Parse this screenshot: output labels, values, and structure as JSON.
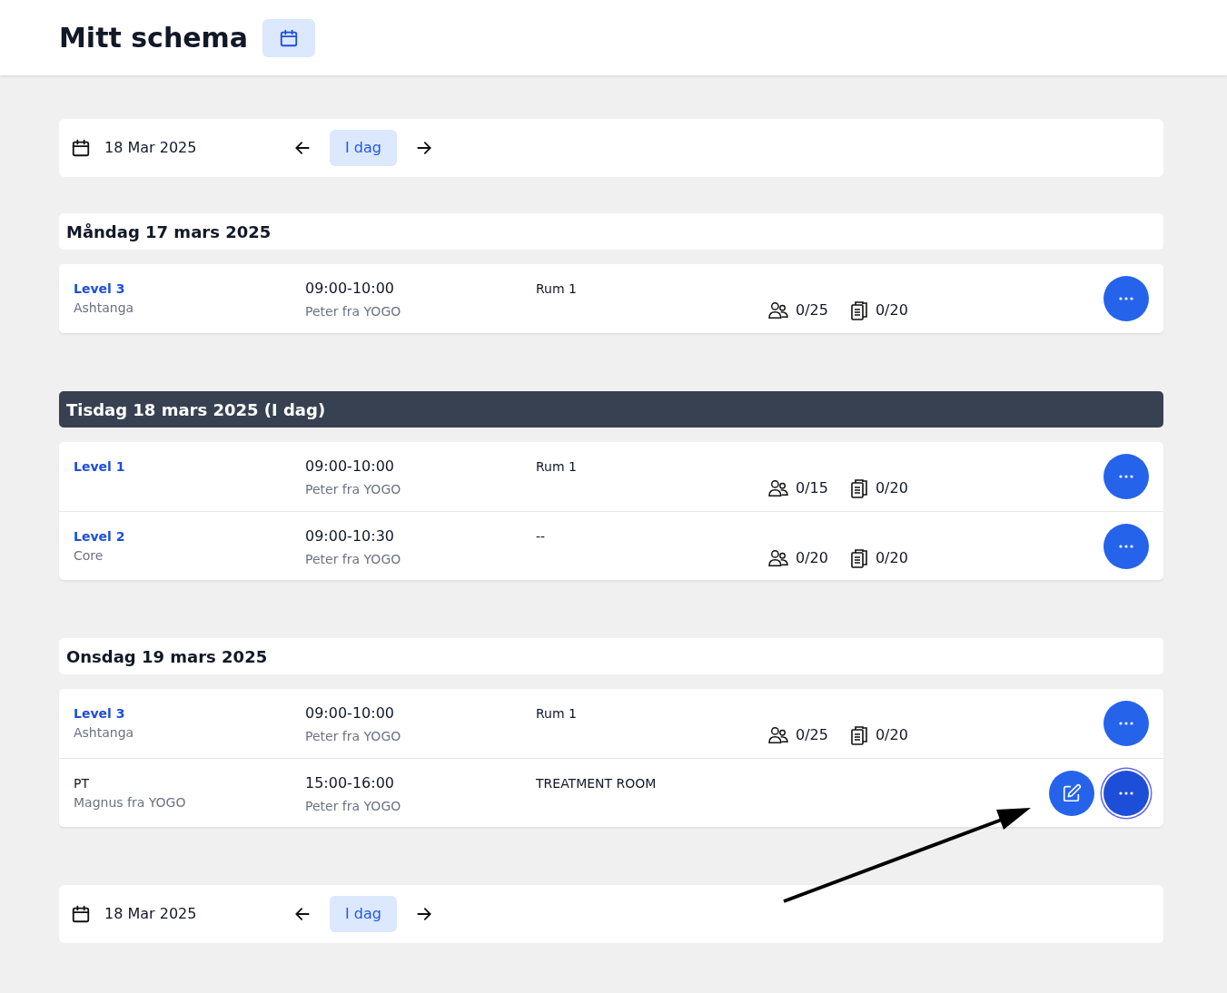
{
  "header": {
    "title": "Mitt schema"
  },
  "nav_top": {
    "date": "18 Mar 2025",
    "today_label": "I dag"
  },
  "days": [
    {
      "title": "Måndag 17 mars 2025",
      "today": false,
      "items": [
        {
          "kind": "class",
          "title": "Level 3",
          "subtitle": "Ashtanga",
          "time": "09:00-10:00",
          "teacher": "Peter fra YOGO",
          "room": "Rum 1",
          "signups": "0/25",
          "waitlist": "0/20",
          "focused": false
        }
      ]
    },
    {
      "title": "Tisdag 18 mars 2025 (I dag)",
      "today": true,
      "items": [
        {
          "kind": "class",
          "title": "Level 1",
          "time": "09:00-10:00",
          "teacher": "Peter fra YOGO",
          "room": "Rum 1",
          "signups": "0/15",
          "waitlist": "0/20",
          "focused": false
        },
        {
          "kind": "class",
          "title": "Level 2",
          "subtitle": "Core",
          "time": "09:00-10:30",
          "teacher": "Peter fra YOGO",
          "room": "--",
          "signups": "0/20",
          "waitlist": "0/20",
          "focused": false
        }
      ]
    },
    {
      "title": "Onsdag 19 mars 2025",
      "today": false,
      "items": [
        {
          "kind": "class",
          "title": "Level 3",
          "subtitle": "Ashtanga",
          "time": "09:00-10:00",
          "teacher": "Peter fra YOGO",
          "room": "Rum 1",
          "signups": "0/25",
          "waitlist": "0/20",
          "focused": false
        },
        {
          "kind": "appointment",
          "title": "PT",
          "subtitle": "Magnus fra YOGO",
          "time": "15:00-16:00",
          "teacher": "Peter fra YOGO",
          "room": "TREATMENT ROOM",
          "editable": true,
          "focused": true
        }
      ]
    }
  ],
  "nav_bottom": {
    "date": "18 Mar 2025",
    "today_label": "I dag"
  }
}
